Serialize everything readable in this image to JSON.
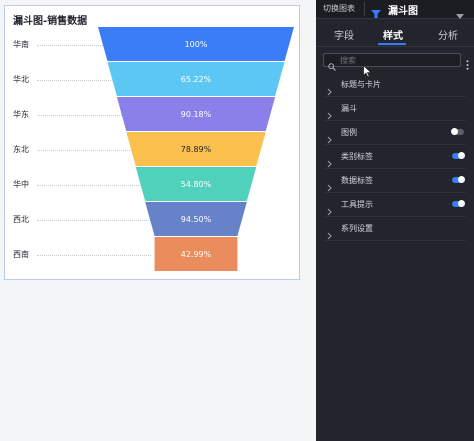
{
  "canvas": {
    "card_title": "漏斗图-销售数据"
  },
  "chart_data": {
    "type": "funnel",
    "title": "漏斗图-销售数据",
    "categories": [
      "华南",
      "华北",
      "华东",
      "东北",
      "华中",
      "西北",
      "西南"
    ],
    "values_label": [
      "100%",
      "65.22%",
      "90.18%",
      "78.89%",
      "54.80%",
      "94.50%",
      "42.99%"
    ],
    "values": [
      100,
      65.22,
      90.18,
      78.89,
      54.8,
      94.5,
      42.99
    ],
    "colors": [
      "#3b7cf7",
      "#5cc7f2",
      "#8b80ea",
      "#fcc04e",
      "#4fd1bb",
      "#6683c9",
      "#ea8c5b"
    ]
  },
  "panel": {
    "switch_label": "切换图表",
    "chart_type": "漏斗图",
    "tabs": [
      {
        "label": "字段"
      },
      {
        "label": "样式"
      },
      {
        "label": "分析"
      }
    ],
    "search_placeholder": "搜索",
    "sections": [
      {
        "label": "标题与卡片",
        "toggle": null
      },
      {
        "label": "漏斗",
        "toggle": null
      },
      {
        "label": "图例",
        "toggle": "off"
      },
      {
        "label": "类别标签",
        "toggle": "on"
      },
      {
        "label": "数据标签",
        "toggle": "on"
      },
      {
        "label": "工具提示",
        "toggle": "on"
      },
      {
        "label": "系列设置",
        "toggle": null
      }
    ],
    "accent": "#3a7bff"
  }
}
